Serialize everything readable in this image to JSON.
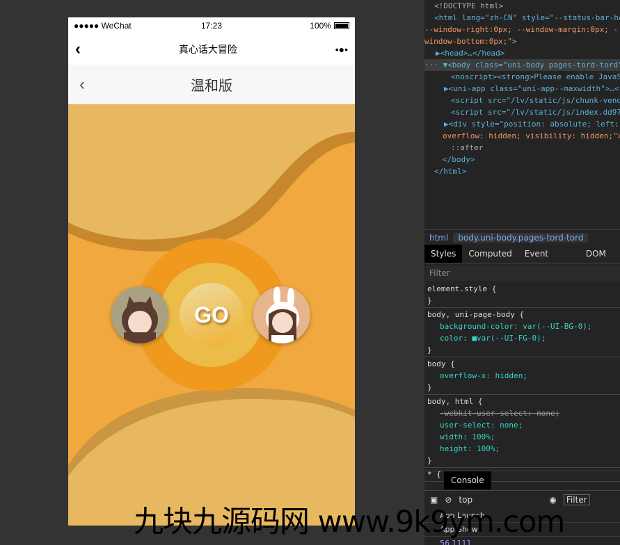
{
  "phone": {
    "status": {
      "carrier": "●●●●● WeChat",
      "time": "17:23",
      "battery": "100%"
    },
    "nav": {
      "title": "真心话大冒险",
      "back": "‹",
      "more": "•●•"
    },
    "sub": {
      "title": "温和版",
      "back": "‹"
    },
    "go_label": "GO",
    "colors": {
      "bg": "#f0a83f",
      "ring_outer": "#ef991f",
      "ring_mid": "#ecbc48"
    }
  },
  "devtools": {
    "dom": [
      "<!DOCTYPE html>",
      "<html lang=\"zh-CN\" style=\"--status-bar-he",
      "--window-right:0px; --window-margin:0px; -",
      "window-bottom:0px;\">",
      "▶<head>…</head>",
      "··· ▼<body class=\"uni-body pages-tord-tord\">",
      "<noscript><strong>Please enable JavaS",
      "▶<uni-app class=\"uni-app--maxwidth\">…<",
      "<script src=\"/lv/static/js/chunk-vend",
      "<script src=\"/lv/static/js/index.dd97",
      "▶<div style=\"position: absolute; left:",
      "overflow: hidden; visibility: hidden;\">",
      "::after",
      "</body>",
      "</html>"
    ],
    "breadcrumb": [
      "html",
      "body.uni-body.pages-tord-tord"
    ],
    "tabs": [
      "Styles",
      "Computed",
      "Event Listeners",
      "DOM Bre"
    ],
    "filter_placeholder": "Filter",
    "rules": [
      {
        "selector": "element.style {",
        "props": []
      },
      {
        "selector": "body, uni-page-body {",
        "props": [
          "background-color: var(--UI-BG-0);",
          "color: ■var(--UI-FG-0);"
        ]
      },
      {
        "selector": "body {",
        "props": [
          "overflow-x: hidden;"
        ]
      },
      {
        "selector": "body, html {",
        "props": [
          "-webkit-user-select: none;",
          "user-select: none;",
          "width: 100%;",
          "height: 100%;"
        ]
      },
      {
        "selector": "* {",
        "props": []
      }
    ],
    "console_tab": "Console",
    "context": "top",
    "console_filter": "Filter",
    "messages": [
      "App Launch",
      "App Show",
      "56 1111"
    ]
  },
  "watermark": "九块九源码网 www.9k9ym.com"
}
